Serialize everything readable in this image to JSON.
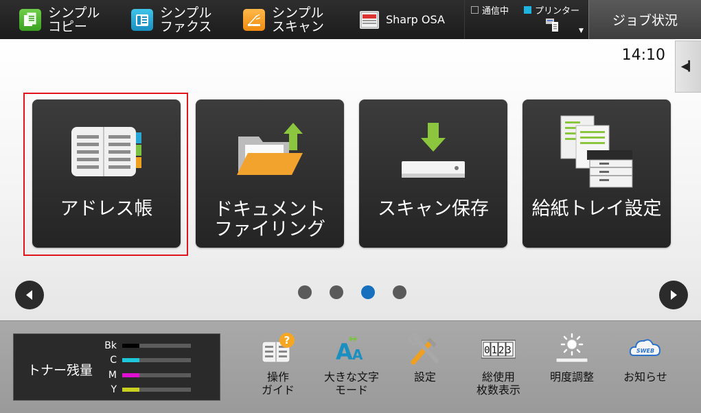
{
  "header": {
    "shortcuts": [
      {
        "label": "シンプル\nコピー",
        "icon": "copy-icon"
      },
      {
        "label": "シンプル\nファクス",
        "icon": "fax-icon"
      },
      {
        "label": "シンプル\nスキャン",
        "icon": "scan-icon"
      },
      {
        "label": "Sharp OSA",
        "icon": "osa-icon"
      }
    ],
    "status": {
      "communicating": "通信中",
      "printer": "プリンター"
    },
    "job_status_label": "ジョブ状況",
    "colors": {
      "printer_indicator": "#1fb4e0"
    }
  },
  "main": {
    "clock": "14:10",
    "tiles": [
      {
        "label": "アドレス帳",
        "icon": "address-book-icon"
      },
      {
        "label": "ドキュメント\nファイリング",
        "icon": "document-filing-icon"
      },
      {
        "label": "スキャン保存",
        "icon": "scan-save-icon"
      },
      {
        "label": "給紙トレイ設定",
        "icon": "paper-tray-icon"
      }
    ],
    "selected_tile": "アドレス帳",
    "page_count": 4,
    "current_page": 3,
    "colors": {
      "selection": "#e0151b",
      "active_dot": "#1670be"
    }
  },
  "footer": {
    "toner": {
      "title": "トナー残量",
      "levels": [
        {
          "name": "Bk",
          "color": "#000000",
          "level": 0.25
        },
        {
          "name": "C",
          "color": "#1fc8d8",
          "level": 0.25
        },
        {
          "name": "M",
          "color": "#e010d0",
          "level": 0.25
        },
        {
          "name": "Y",
          "color": "#c8d020",
          "level": 0.25
        }
      ]
    },
    "buttons": [
      {
        "label": "操作\nガイド",
        "icon": "operation-guide-icon"
      },
      {
        "label": "大きな文字\nモード",
        "icon": "large-text-icon"
      },
      {
        "label": "設定",
        "icon": "settings-tools-icon"
      },
      {
        "label": "総使用\n枚数表示",
        "icon": "counter-icon"
      },
      {
        "label": "明度調整",
        "icon": "brightness-icon"
      },
      {
        "label": "お知らせ",
        "icon": "web-notice-icon"
      }
    ],
    "counter_digits": "0123"
  }
}
